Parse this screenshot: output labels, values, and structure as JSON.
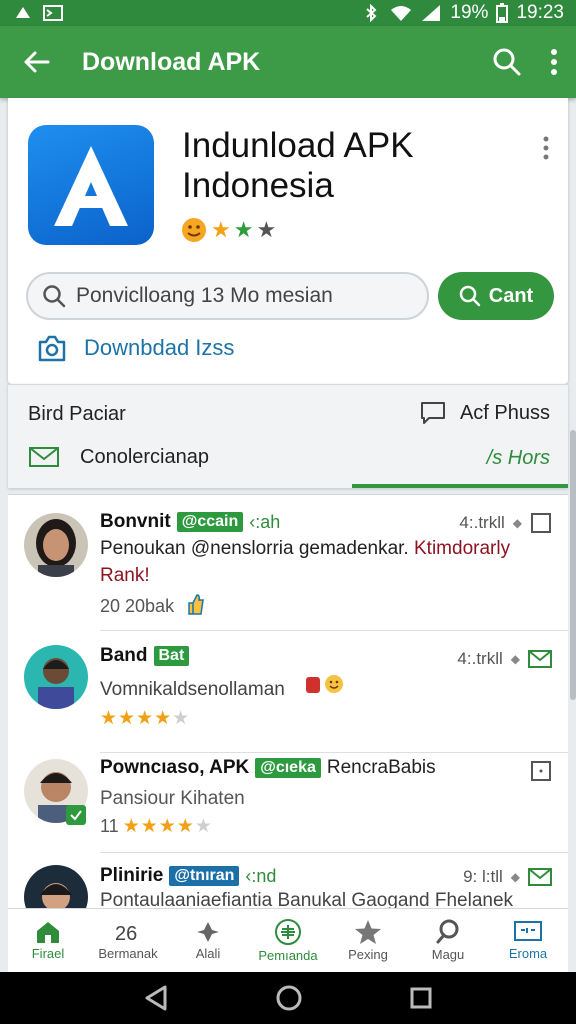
{
  "status_bar": {
    "battery": "19%",
    "time": "19:23"
  },
  "app_bar": {
    "title": "Download APK"
  },
  "app": {
    "name": "Indunload APK Indonesia",
    "rating_stars": 3
  },
  "search": {
    "text": "Ponvicl​loang 13 Mo mesian",
    "button_label": "Cant"
  },
  "download_link": {
    "label": "Downbdad Izss"
  },
  "filters": {
    "sort_label": "Bird Paciar",
    "filter_label": "Acf Phuss",
    "category_label": "Conolercianap",
    "view_all_label": "/s Hors"
  },
  "reviews": [
    {
      "name": "Bonvnit",
      "badge": "@ccain",
      "suffix": "‹:ah",
      "meta": "4:.trkll",
      "text_main": "Penoukan @nenslorria gemadenkar.",
      "text_highlight": "Ktimdorarly Rank!",
      "sub": "20 20bak"
    },
    {
      "name": "Band",
      "badge": "Bat",
      "meta": "4:.trkll",
      "text_main": "Vomnikaldsenollaman",
      "rating": 4
    },
    {
      "name": "Powncıaso, APK",
      "badge": "@cıeka",
      "suffix_plain": "RencraBabis",
      "text_main": "Pansiour Kihaten",
      "sub_prefix": "11",
      "rating": 4
    },
    {
      "name": "Plinirie",
      "badge": "@tnıran",
      "suffix": "‹:nd",
      "meta": "9: l:tll",
      "text_main": "Pontaulaaniaefiantia Banukal Gaogand Fhelanek"
    }
  ],
  "bottom_nav": [
    {
      "label": "Firael",
      "icon": "home-icon"
    },
    {
      "label": "Bermanak",
      "icon": "numbers-icon"
    },
    {
      "label": "Alali",
      "icon": "puzzle-icon"
    },
    {
      "label": "Pemıanda",
      "icon": "add-circle-icon"
    },
    {
      "label": "Pexing",
      "icon": "star-icon"
    },
    {
      "label": "Magu",
      "icon": "search-icon"
    },
    {
      "label": "Eroma",
      "icon": "tv-icon"
    }
  ],
  "colors": {
    "primary": "#3d9a47",
    "status_bar": "#2f8a3e",
    "accent_blue": "#1d73a8",
    "star": "#f2a016"
  }
}
